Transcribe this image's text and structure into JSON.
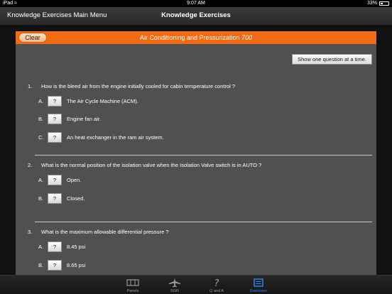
{
  "status_bar": {
    "device": "iPad",
    "time": "9:07 AM",
    "battery": "33%"
  },
  "nav": {
    "back_label": "Knowledge Exercises Main Menu",
    "title": "Knowledge Exercises"
  },
  "panel": {
    "clear_label": "Clear",
    "title": "Air Conditioning and Pressurization",
    "title_number": "700",
    "show_one_label": "Show one question at a time."
  },
  "questions": [
    {
      "number": "1.",
      "text": "How is the bleed air from the engine initially cooled for cabin temperature control ?",
      "answers": [
        {
          "letter": "A.",
          "button": "?",
          "text": "The Air Cycle Machine (ACM)."
        },
        {
          "letter": "B.",
          "button": "?",
          "text": "Engine fan air."
        },
        {
          "letter": "C.",
          "button": "?",
          "text": "An heat exchanger in the ram air system."
        }
      ]
    },
    {
      "number": "2.",
      "text": "What is the normal position of the isolation valve when the Isolation Valve switch is in AUTO ?",
      "answers": [
        {
          "letter": "A.",
          "button": "?",
          "text": "Open."
        },
        {
          "letter": "B.",
          "button": "?",
          "text": "Closed."
        }
      ]
    },
    {
      "number": "3.",
      "text": "What is the maximum allowable differential pressure ?",
      "answers": [
        {
          "letter": "A.",
          "button": "?",
          "text": "8.45 psi"
        },
        {
          "letter": "B.",
          "button": "?",
          "text": "8.65 psi"
        }
      ]
    }
  ],
  "tabs": [
    {
      "label": "Panels",
      "icon": "panels-icon",
      "active": false
    },
    {
      "label": "SGR",
      "icon": "airplane-icon",
      "active": false
    },
    {
      "label": "Q and A",
      "icon": "question-icon",
      "active": false
    },
    {
      "label": "Exercises",
      "icon": "exercises-icon",
      "active": true
    }
  ],
  "colors": {
    "accent": "#f26b12",
    "active_tab": "#2b8cff"
  }
}
